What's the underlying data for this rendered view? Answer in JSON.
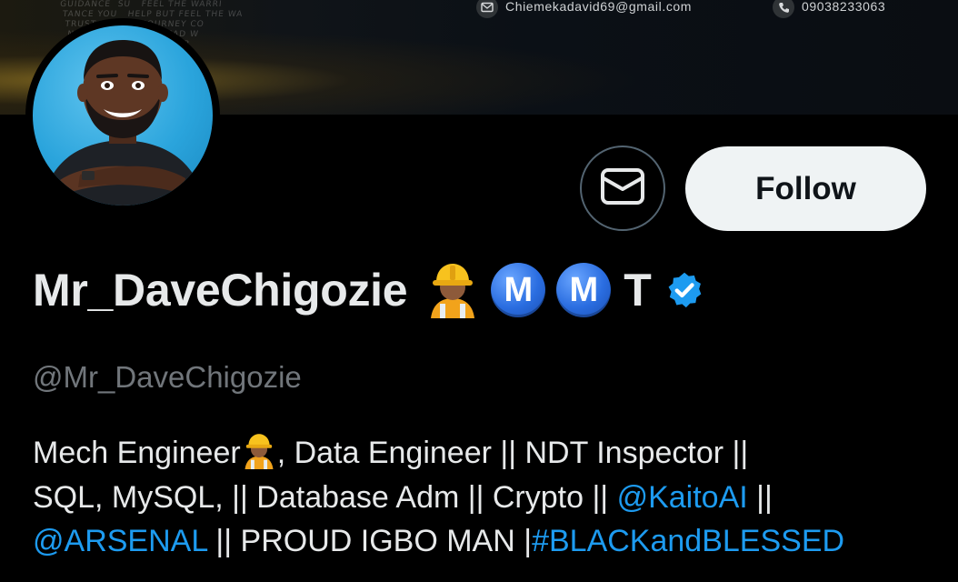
{
  "banner": {
    "email_icon": "mail-icon",
    "email": "Chiemekadavid69@gmail.com",
    "phone_icon": "phone-icon",
    "phone": "09038233063"
  },
  "profile": {
    "avatar_icon": "avatar-icon",
    "display_name": "Mr_DaveChigozie",
    "name_emoji": "construction-worker-icon",
    "badges": [
      "M",
      "M"
    ],
    "name_suffix": "T",
    "verified_icon": "verified-badge-icon",
    "handle": "@Mr_DaveChigozie"
  },
  "actions": {
    "message_icon": "envelope-icon",
    "follow_label": "Follow"
  },
  "bio": {
    "line1_a": "Mech Engineer",
    "line1_emoji": "construction-worker-icon",
    "line1_b": ", Data Engineer || NDT Inspector ||",
    "line2_a": "SQL, MySQL, || Database Adm || Crypto || ",
    "line2_mention": "@KaitoAI",
    "line2_b": " ||",
    "line3_mention": "@ARSENAL",
    "line3_a": " || PROUD IGBO MAN |",
    "line3_hashtag": "#BLACKandBLESSED"
  },
  "colors": {
    "background": "#000000",
    "link": "#1d9bf0",
    "muted": "#71767b",
    "follow_bg": "#eff3f4"
  }
}
